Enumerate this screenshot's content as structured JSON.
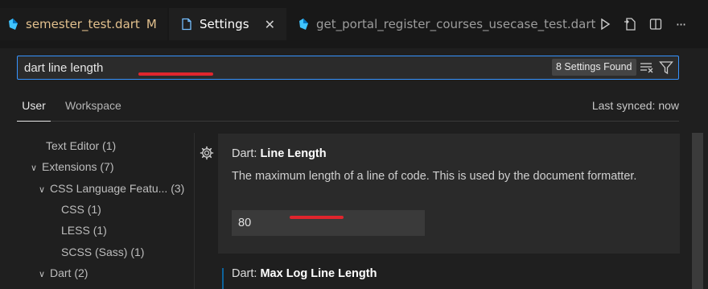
{
  "tabs": [
    {
      "label": "semester_test.dart",
      "modified": "M"
    },
    {
      "label": "Settings"
    },
    {
      "label": "get_portal_register_courses_usecase_test.dart"
    }
  ],
  "toolbar": {
    "icons": [
      "run-icon",
      "open-json-icon",
      "split-editor-icon",
      "more-icon"
    ],
    "more_glyph": "···"
  },
  "search": {
    "value": "dart line length",
    "found_label": "8 Settings Found"
  },
  "scope": {
    "user_label": "User",
    "workspace_label": "Workspace",
    "sync_status": "Last synced: now"
  },
  "toc": [
    {
      "label": "Text Editor",
      "count": "(1)"
    },
    {
      "label": "Extensions",
      "count": "(7)"
    },
    {
      "label": "CSS Language Featu...",
      "count": "(3)"
    },
    {
      "label": "CSS",
      "count": "(1)"
    },
    {
      "label": "LESS",
      "count": "(1)"
    },
    {
      "label": "SCSS (Sass)",
      "count": "(1)"
    },
    {
      "label": "Dart",
      "count": "(2)"
    }
  ],
  "settings": [
    {
      "category": "Dart: ",
      "name": "Line Length",
      "description": "The maximum length of a line of code. This is used by the document formatter.",
      "value": "80"
    },
    {
      "category": "Dart: ",
      "name": "Max Log Line Length"
    }
  ],
  "colors": {
    "accent": "#3794ff",
    "annotation": "#e0252d",
    "modified": "#e2c08d",
    "dart_blue": "#40c4ff"
  }
}
